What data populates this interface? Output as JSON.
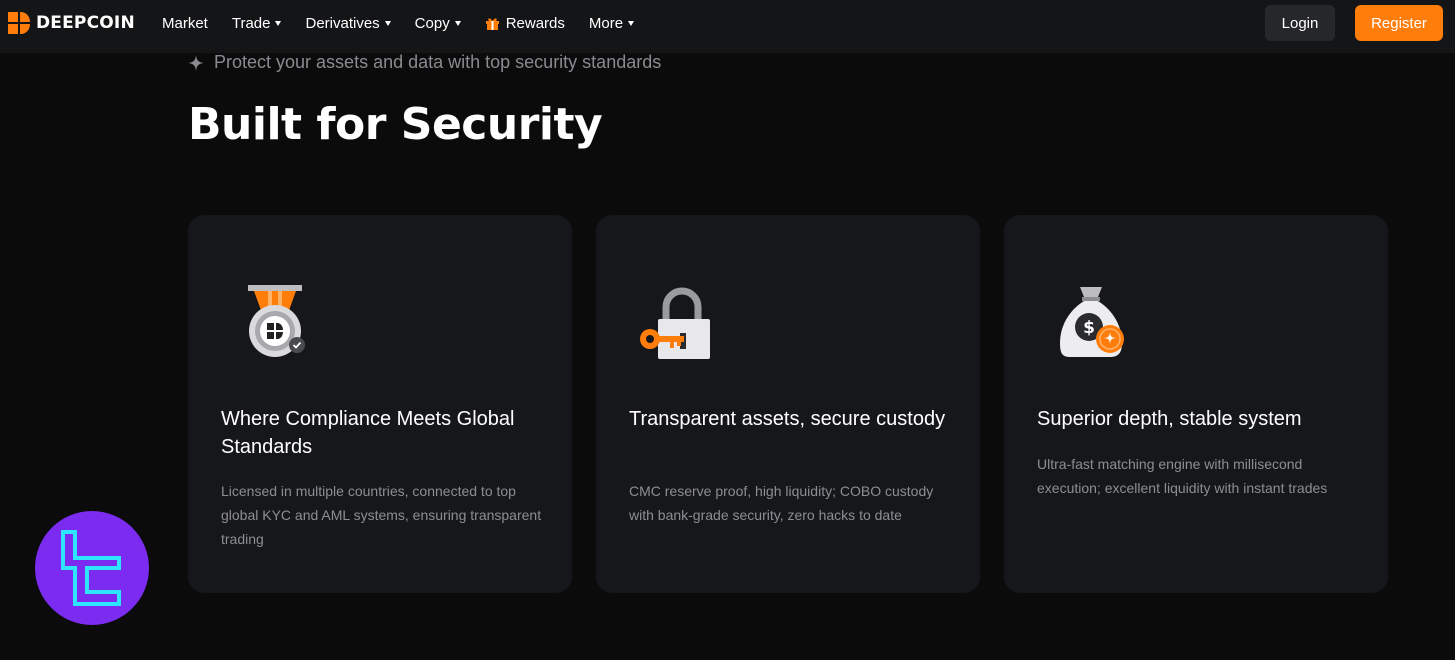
{
  "header": {
    "brand_name": "DEEPCOIN",
    "nav": [
      {
        "label": "Market",
        "has_caret": false
      },
      {
        "label": "Trade",
        "has_caret": true
      },
      {
        "label": "Derivatives",
        "has_caret": true
      },
      {
        "label": "Copy",
        "has_caret": true
      },
      {
        "label": "Rewards",
        "has_caret": false,
        "icon": "gift-icon"
      },
      {
        "label": "More",
        "has_caret": true
      }
    ],
    "login_label": "Login",
    "register_label": "Register"
  },
  "hero": {
    "tagline": "Protect your assets and data with top security standards",
    "title": "Built for Security"
  },
  "cards": [
    {
      "icon": "medal-badge-icon",
      "title": "Where Compliance Meets Global Standards",
      "desc": "Licensed in multiple countries, connected to top global KYC and AML systems, ensuring transparent trading"
    },
    {
      "icon": "padlock-key-icon",
      "title": "Transparent assets, secure custody",
      "desc": "CMC reserve proof, high liquidity; COBO custody with bank-grade security, zero hacks to date"
    },
    {
      "icon": "money-bag-icon",
      "title": "Superior depth, stable system",
      "desc": "Ultra-fast matching engine with millisecond execution; excellent liquidity with instant trades"
    }
  ],
  "colors": {
    "accent": "#ff7d0a",
    "background": "#0b0b0c",
    "navbar": "#141517",
    "card": "#16171a",
    "badge": "#7b2cf0"
  }
}
